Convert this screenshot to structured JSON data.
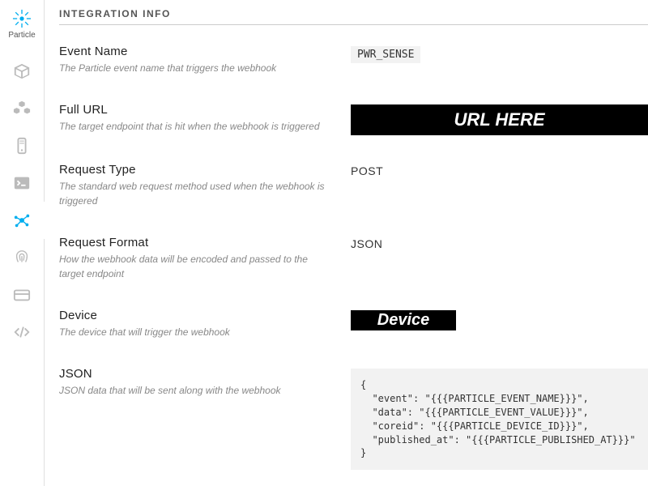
{
  "brand": {
    "name": "Particle"
  },
  "sidebar": {
    "items": [
      {
        "name": "box-icon"
      },
      {
        "name": "cubes-icon"
      },
      {
        "name": "phone-icon"
      },
      {
        "name": "terminal-icon"
      },
      {
        "name": "integrations-icon"
      },
      {
        "name": "fingerprint-icon"
      },
      {
        "name": "card-icon"
      },
      {
        "name": "code-icon"
      }
    ]
  },
  "section": {
    "title": "INTEGRATION INFO"
  },
  "fields": {
    "event": {
      "label": "Event Name",
      "desc": "The Particle event name that triggers the webhook",
      "value": "PWR_SENSE"
    },
    "url": {
      "label": "Full URL",
      "desc": "The target endpoint that is hit when the webhook is triggered",
      "value": "URL HERE"
    },
    "requestType": {
      "label": "Request Type",
      "desc": "The standard web request method used when the webhook is triggered",
      "value": "POST"
    },
    "requestFormat": {
      "label": "Request Format",
      "desc": "How the webhook data will be encoded and passed to the target endpoint",
      "value": "JSON"
    },
    "device": {
      "label": "Device",
      "desc": "The device that will trigger the webhook",
      "value": "Device"
    },
    "json": {
      "label": "JSON",
      "desc": "JSON data that will be sent along with the webhook",
      "value": "{\n  \"event\": \"{{{PARTICLE_EVENT_NAME}}}\",\n  \"data\": \"{{{PARTICLE_EVENT_VALUE}}}\",\n  \"coreid\": \"{{{PARTICLE_DEVICE_ID}}}\",\n  \"published_at\": \"{{{PARTICLE_PUBLISHED_AT}}}\"\n}"
    }
  }
}
